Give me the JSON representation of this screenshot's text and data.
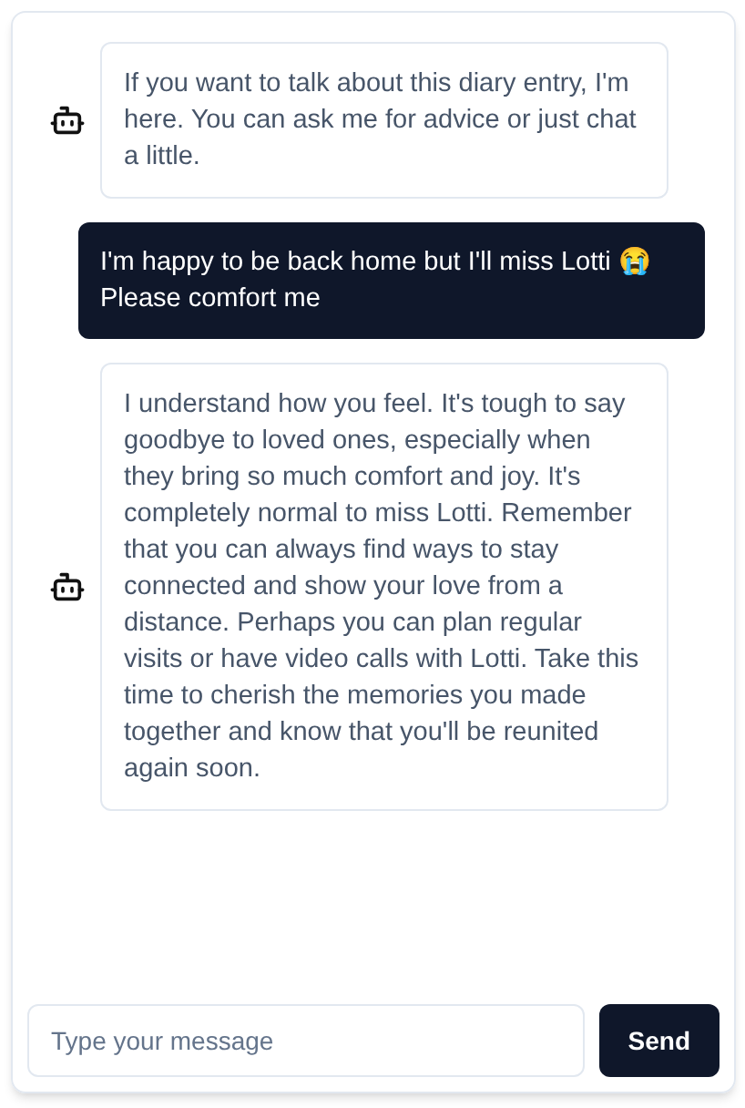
{
  "messages": [
    {
      "kind": "bot",
      "text": "If you want to talk about this diary entry, I'm here. You can ask me for advice or just chat a little."
    },
    {
      "kind": "user",
      "text": "I'm happy to be back home but I'll miss Lotti 😭 Please comfort me"
    },
    {
      "kind": "bot",
      "text": "I understand how you feel. It's tough to say goodbye to loved ones, especially when they bring so much comfort and joy. It's completely normal to miss Lotti. Remember that you can always find ways to stay connected and show your love from a distance. Perhaps you can plan regular visits or have video calls with Lotti. Take this time to cherish the memories you made together and know that you'll be reunited again soon."
    }
  ],
  "composer": {
    "placeholder": "Type your message",
    "button": "Send"
  }
}
